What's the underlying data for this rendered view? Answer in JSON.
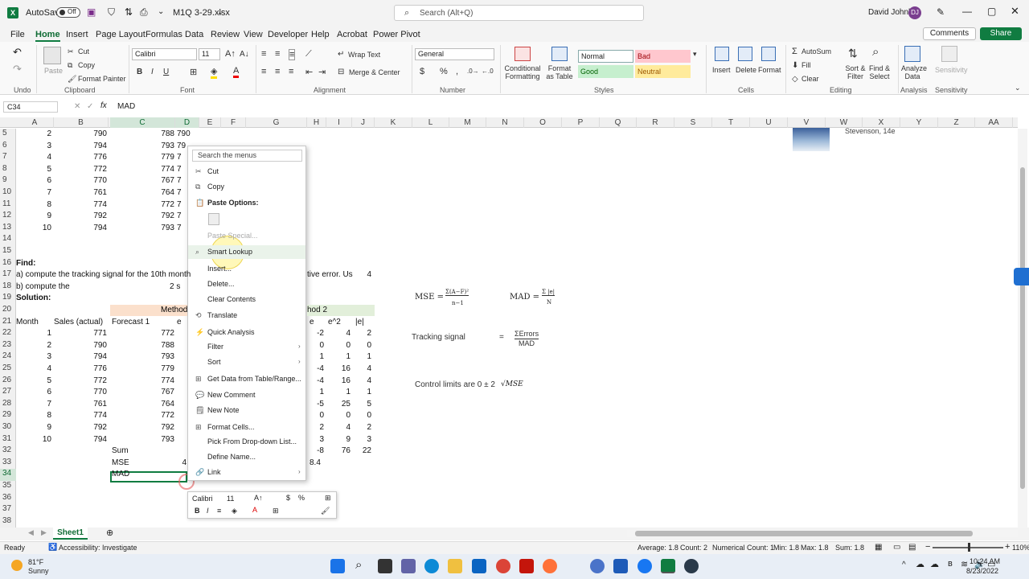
{
  "titlebar": {
    "autosave": "AutoSave",
    "autosave_state": "Off",
    "filename": "M1Q 3-29.xlsx",
    "search_placeholder": "Search (Alt+Q)",
    "user": "David Johnk",
    "user_initials": "DJ"
  },
  "tabs": [
    "File",
    "Home",
    "Insert",
    "Page Layout",
    "Formulas",
    "Data",
    "Review",
    "View",
    "Developer",
    "Help",
    "Acrobat",
    "Power Pivot"
  ],
  "comments_label": "Comments",
  "share_label": "Share",
  "ribbon": {
    "undo_group": "Undo",
    "clipboard": {
      "paste": "Paste",
      "cut": "Cut",
      "copy": "Copy",
      "format_painter": "Format Painter",
      "label": "Clipboard"
    },
    "font": {
      "name": "Calibri",
      "size": "11",
      "label": "Font"
    },
    "alignment": {
      "wrap": "Wrap Text",
      "merge": "Merge & Center",
      "label": "Alignment"
    },
    "number": {
      "format": "General",
      "label": "Number"
    },
    "styles": {
      "cond": "Conditional Formatting",
      "table": "Format as Table",
      "normal": "Normal",
      "bad": "Bad",
      "good": "Good",
      "neutral": "Neutral",
      "label": "Styles"
    },
    "cells": {
      "insert": "Insert",
      "delete": "Delete",
      "format": "Format",
      "label": "Cells"
    },
    "editing": {
      "autosum": "AutoSum",
      "fill": "Fill",
      "clear": "Clear",
      "sort": "Sort & Filter",
      "find": "Find & Select",
      "label": "Editing"
    },
    "analysis": {
      "analyze": "Analyze Data",
      "label": "Analysis"
    },
    "sensitivity": {
      "btn": "Sensitivity",
      "label": "Sensitivity"
    }
  },
  "formula_bar": {
    "namebox": "C34",
    "fx": "fx",
    "content": "MAD"
  },
  "columns": [
    "A",
    "B",
    "C",
    "D",
    "E",
    "F",
    "G",
    "H",
    "I",
    "J",
    "K",
    "L",
    "M",
    "N",
    "O",
    "P",
    "Q",
    "R",
    "S",
    "T",
    "U",
    "V",
    "W",
    "X",
    "Y",
    "Z",
    "AA"
  ],
  "rows": [
    "5",
    "6",
    "7",
    "8",
    "9",
    "10",
    "11",
    "12",
    "13",
    "14",
    "15",
    "16",
    "17",
    "18",
    "19",
    "20",
    "21",
    "22",
    "23",
    "24",
    "25",
    "26",
    "27",
    "28",
    "29",
    "30",
    "31",
    "32",
    "33",
    "34",
    "35",
    "36",
    "37",
    "38"
  ],
  "top_table": [
    [
      "2",
      "790",
      "788",
      "790"
    ],
    [
      "3",
      "794",
      "793",
      "79"
    ],
    [
      "4",
      "776",
      "779",
      "7"
    ],
    [
      "5",
      "772",
      "774",
      "7"
    ],
    [
      "6",
      "770",
      "767",
      "7"
    ],
    [
      "7",
      "761",
      "764",
      "7"
    ],
    [
      "8",
      "774",
      "772",
      "7"
    ],
    [
      "9",
      "792",
      "792",
      "7"
    ],
    [
      "10",
      "794",
      "793",
      "7"
    ]
  ],
  "find_label": "Find:",
  "question_a": "a) compute the tracking signal for the 10th month",
  "question_a_tail": "tive error.  Us",
  "question_a_value": "4",
  "question_b": "b) compute the",
  "question_b_tail": "2 s",
  "solution_label": "Solution:",
  "method_header": "Method",
  "method2_header": "hod 2",
  "sol_headers": {
    "month": "Month",
    "sales": "Sales (actual)",
    "forecast": "Forecast 1",
    "e": "e",
    "e2": "e",
    "esq": "e^2",
    "abs": "|e|"
  },
  "solution_rows": [
    [
      "1",
      "771",
      "772",
      "-2",
      "4",
      "2"
    ],
    [
      "2",
      "790",
      "788",
      "0",
      "0",
      "0"
    ],
    [
      "3",
      "794",
      "793",
      "1",
      "1",
      "1"
    ],
    [
      "4",
      "776",
      "779",
      "-4",
      "16",
      "4"
    ],
    [
      "5",
      "772",
      "774",
      "-4",
      "16",
      "4"
    ],
    [
      "6",
      "770",
      "767",
      "1",
      "1",
      "1"
    ],
    [
      "7",
      "761",
      "764",
      "-5",
      "25",
      "5"
    ],
    [
      "8",
      "774",
      "772",
      "0",
      "0",
      "0"
    ],
    [
      "9",
      "792",
      "792",
      "2",
      "4",
      "2"
    ],
    [
      "10",
      "794",
      "793",
      "3",
      "9",
      "3"
    ]
  ],
  "sum_label": "Sum",
  "sum_values": [
    "-8",
    "76",
    "22"
  ],
  "mse_label": "MSE",
  "mse_value_c": "4",
  "mse_value": "8.4",
  "mad_label": "MAD",
  "image_caption": "Stevenson, 14e",
  "formulas": {
    "mse": "MSE =",
    "mse_num": "Σ(A−F)²",
    "mse_den": "n−1",
    "mad": "MAD =",
    "mad_num": "Σ |e|",
    "mad_den": "N",
    "tracking": "Tracking signal",
    "ts_num": "ΣErrors",
    "ts_den": "MAD",
    "control": "Control limits are 0 ± 2",
    "control_sqrt": "√MSE"
  },
  "context_menu": {
    "search": "Search the menus",
    "items": [
      "Cut",
      "Copy",
      "Paste Options:",
      "Paste Special...",
      "Smart Lookup",
      "Insert...",
      "Delete...",
      "Clear Contents",
      "Translate",
      "Quick Analysis",
      "Filter",
      "Sort",
      "Get Data from Table/Range...",
      "New Comment",
      "New Note",
      "Format Cells...",
      "Pick From Drop-down List...",
      "Define Name...",
      "Link"
    ]
  },
  "mini_toolbar": {
    "font": "Calibri",
    "size": "11"
  },
  "sheet_tab": "Sheet1",
  "status": {
    "ready": "Ready",
    "accessibility": "Accessibility: Investigate",
    "average": "Average: 1.8",
    "count": "Count: 2",
    "numcount": "Numerical Count: 1",
    "min": "Min: 1.8",
    "max": "Max: 1.8",
    "sum": "Sum: 1.8",
    "zoom": "110%"
  },
  "taskbar": {
    "temp": "81°F",
    "weather": "Sunny",
    "time": "10:24 AM",
    "date": "8/23/2022"
  }
}
